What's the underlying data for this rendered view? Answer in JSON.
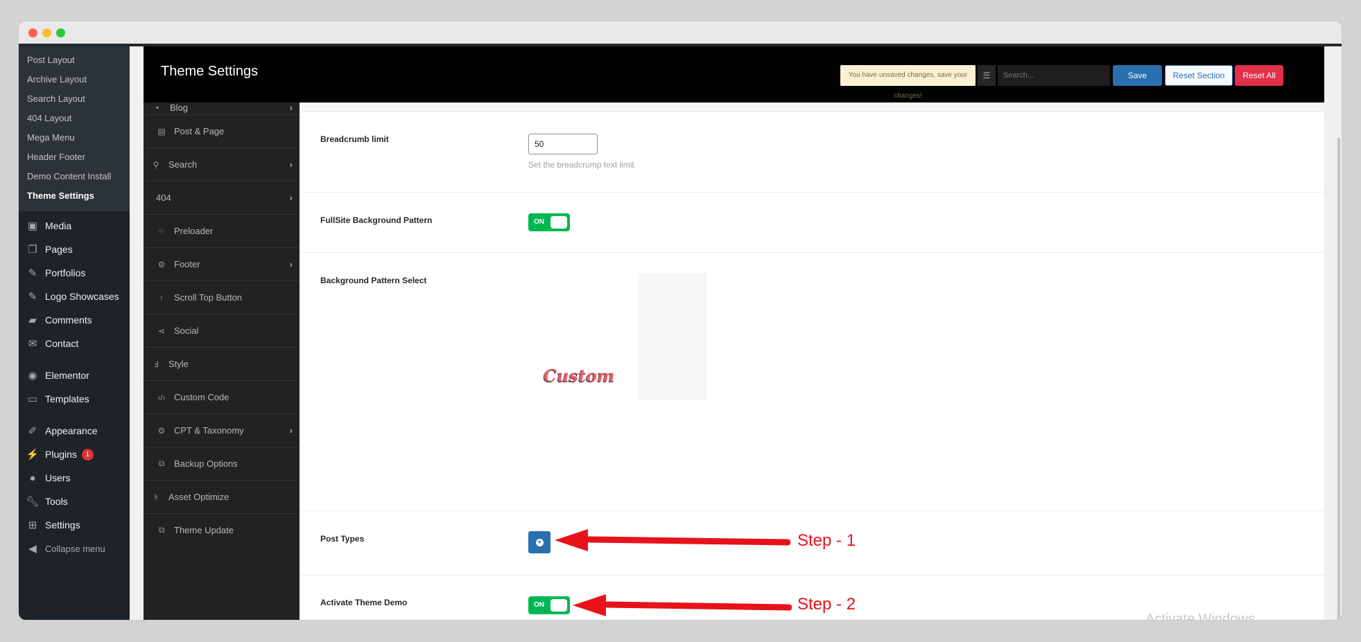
{
  "window": {
    "controls": [
      "close",
      "minimize",
      "maximize"
    ]
  },
  "wp_sidebar": {
    "submenu": [
      {
        "label": "Post Layout",
        "current": false
      },
      {
        "label": "Archive Layout",
        "current": false
      },
      {
        "label": "Search Layout",
        "current": false
      },
      {
        "label": "404 Layout",
        "current": false
      },
      {
        "label": "Mega Menu",
        "current": false
      },
      {
        "label": "Header Footer",
        "current": false
      },
      {
        "label": "Demo Content Install",
        "current": false
      },
      {
        "label": "Theme Settings",
        "current": true
      }
    ],
    "menu": [
      {
        "label": "Media",
        "icon": "media-icon"
      },
      {
        "label": "Pages",
        "icon": "pages-icon"
      },
      {
        "label": "Portfolios",
        "icon": "pin-icon"
      },
      {
        "label": "Logo Showcases",
        "icon": "pin-icon"
      },
      {
        "label": "Comments",
        "icon": "comment-icon"
      },
      {
        "label": "Contact",
        "icon": "mail-icon"
      },
      {
        "label": "Elementor",
        "icon": "elementor-icon"
      },
      {
        "label": "Templates",
        "icon": "folder-icon"
      },
      {
        "label": "Appearance",
        "icon": "paintbrush-icon"
      },
      {
        "label": "Plugins",
        "icon": "plug-icon",
        "badge": "1"
      },
      {
        "label": "Users",
        "icon": "user-icon"
      },
      {
        "label": "Tools",
        "icon": "wrench-icon"
      },
      {
        "label": "Settings",
        "icon": "settings-icon"
      },
      {
        "label": "Collapse menu",
        "icon": "collapse-icon"
      }
    ]
  },
  "options_sidebar": {
    "items": [
      {
        "label": "Blog",
        "icon": "archive-icon",
        "has_children": true
      },
      {
        "label": "Post & Page",
        "icon": "book-icon",
        "has_children": false
      },
      {
        "label": "Search",
        "icon": "search-icon",
        "has_children": true
      },
      {
        "label": "404",
        "icon": "",
        "has_children": true
      },
      {
        "label": "Preloader",
        "icon": "spinner-icon",
        "has_children": false
      },
      {
        "label": "Footer",
        "icon": "gear-icon",
        "has_children": true
      },
      {
        "label": "Scroll Top Button",
        "icon": "arrow-up-icon",
        "has_children": false
      },
      {
        "label": "Social",
        "icon": "share-icon",
        "has_children": false
      },
      {
        "label": "Style",
        "icon": "css3-icon",
        "has_children": false
      },
      {
        "label": "Custom Code",
        "icon": "code-icon",
        "has_children": false
      },
      {
        "label": "CPT & Taxonomy",
        "icon": "gear-icon",
        "has_children": true
      },
      {
        "label": "Backup Options",
        "icon": "external-icon",
        "has_children": false
      },
      {
        "label": "Asset Optimize",
        "icon": "stethoscope-icon",
        "has_children": false
      },
      {
        "label": "Theme Update",
        "icon": "external-icon",
        "has_children": false
      }
    ]
  },
  "header": {
    "title": "Theme Settings",
    "notice": "You have unsaved changes, save your changes!",
    "search_placeholder": "Search...",
    "save": "Save",
    "reset_section": "Reset Section",
    "reset_all": "Reset All"
  },
  "fields": {
    "breadcrumb_limit": {
      "label": "Breadcrumb limit",
      "value": "50",
      "description": "Set the breadcrump text limit"
    },
    "fullsite_bg_pattern": {
      "label": "FullSite Background Pattern",
      "state": "ON"
    },
    "bg_pattern_select": {
      "label": "Background Pattern Select",
      "option_label": "Custom"
    },
    "post_types": {
      "label": "Post Types"
    },
    "activate_theme_demo": {
      "label": "Activate Theme Demo",
      "state": "ON"
    }
  },
  "annotations": {
    "step1": "Step - 1",
    "step2": "Step - 2"
  },
  "watermark": "Activate Windows",
  "colors": {
    "accent_blue": "#2a6fb0",
    "toggle_green": "#00b853",
    "danger": "#e0304a",
    "arrow_red": "#e8121a"
  }
}
